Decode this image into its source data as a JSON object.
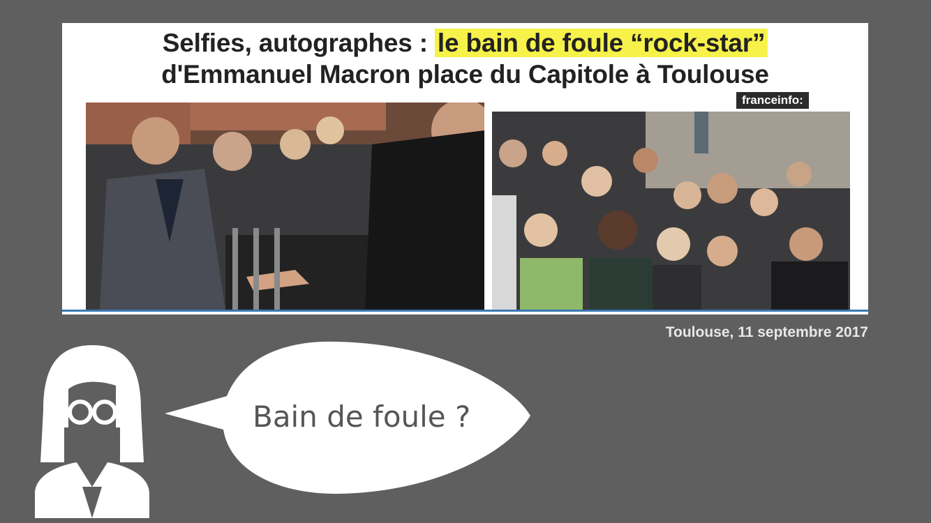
{
  "headline": {
    "line1_plain": "Selfies, autographes : ",
    "line1_highlight": "le bain de foule “rock-star”",
    "line2": "d'Emmanuel Macron place du Capitole à Toulouse"
  },
  "brand": "franceinfo:",
  "photos": {
    "left": "photo-handshake-crowd",
    "right": "photo-cheering-crowd"
  },
  "caption": "Toulouse, 11 septembre 2017",
  "speech": {
    "text": "Bain de foule ?"
  },
  "icons": {
    "person": "woman-with-glasses-icon",
    "bubble": "speech-bubble-icon"
  },
  "colors": {
    "background": "#5f5f5f",
    "highlight": "#f6f24a",
    "accent_line": "#3a78b4"
  }
}
